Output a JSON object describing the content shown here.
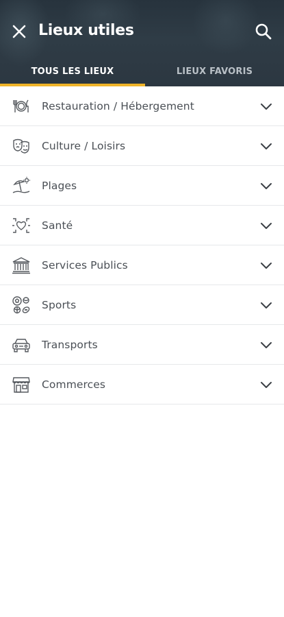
{
  "header": {
    "title": "Lieux utiles",
    "close_icon": "close-icon",
    "search_icon": "search-icon"
  },
  "tabs": [
    {
      "label": "TOUS LES LIEUX",
      "active": true
    },
    {
      "label": "LIEUX FAVORIS",
      "active": false
    }
  ],
  "categories": [
    {
      "label": "Restauration / Hébergement",
      "icon": "utensils-icon"
    },
    {
      "label": "Culture / Loisirs",
      "icon": "theater-masks-icon"
    },
    {
      "label": "Plages",
      "icon": "beach-icon"
    },
    {
      "label": "Santé",
      "icon": "health-heart-icon"
    },
    {
      "label": "Services Publics",
      "icon": "public-building-icon"
    },
    {
      "label": "Sports",
      "icon": "sports-balls-icon"
    },
    {
      "label": "Transports",
      "icon": "car-icon"
    },
    {
      "label": "Commerces",
      "icon": "shop-icon"
    }
  ],
  "colors": {
    "header_bg": "#2c3741",
    "tab_indicator": "#f0b429",
    "text": "#4a4f55",
    "divider": "#e6e8ea"
  }
}
